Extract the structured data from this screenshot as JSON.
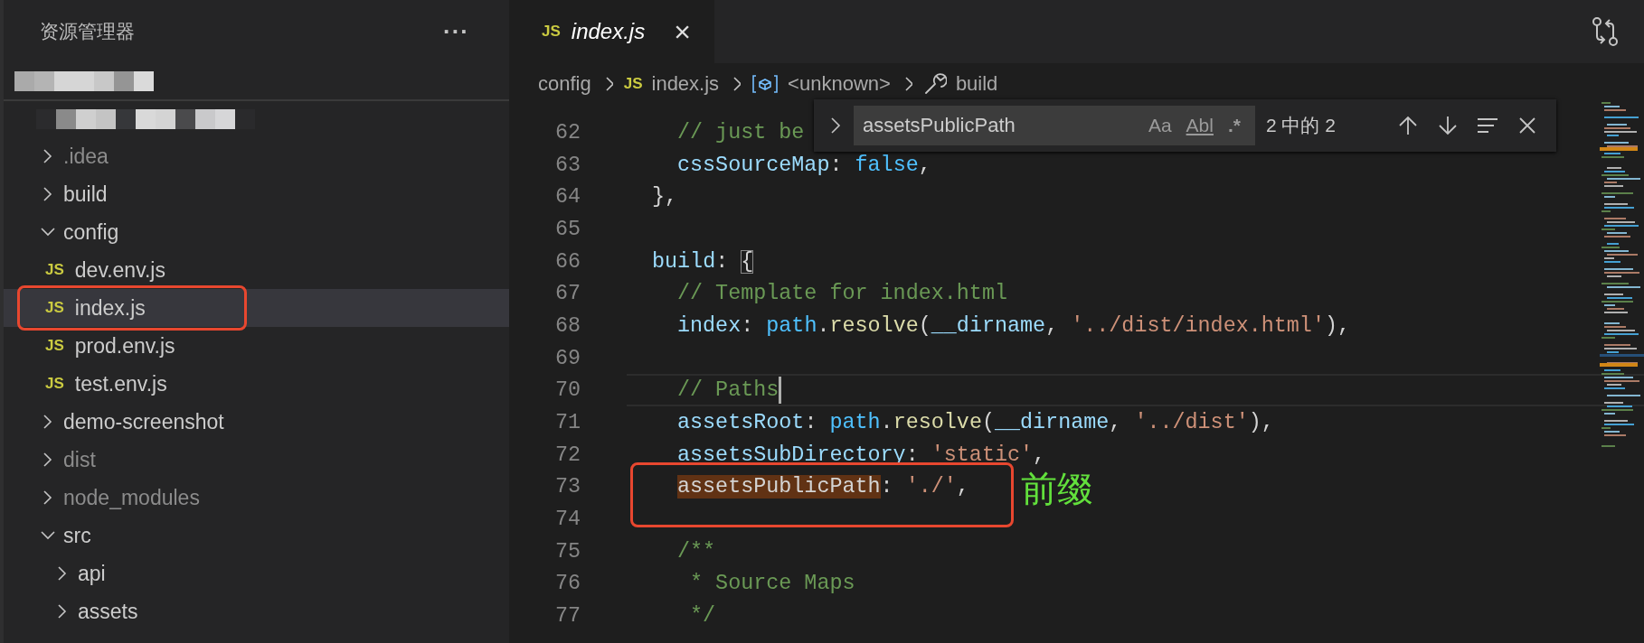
{
  "sidebar": {
    "title": "资源管理器",
    "more": "···",
    "redacted": [
      {
        "kind": "mosaic"
      },
      {
        "kind": "mosaic"
      }
    ],
    "tree": [
      {
        "label": ".idea",
        "kind": "folder",
        "expanded": false,
        "ignored": true,
        "selected": false
      },
      {
        "label": "build",
        "kind": "folder",
        "expanded": false,
        "ignored": false,
        "selected": false
      },
      {
        "label": "config",
        "kind": "folder",
        "expanded": true,
        "ignored": false,
        "selected": false,
        "children": [
          {
            "label": "dev.env.js",
            "kind": "file",
            "icon": "JS",
            "ignored": false,
            "selected": false
          },
          {
            "label": "index.js",
            "kind": "file",
            "icon": "JS",
            "ignored": false,
            "selected": true,
            "annotated": true
          },
          {
            "label": "prod.env.js",
            "kind": "file",
            "icon": "JS",
            "ignored": false,
            "selected": false
          },
          {
            "label": "test.env.js",
            "kind": "file",
            "icon": "JS",
            "ignored": false,
            "selected": false
          }
        ]
      },
      {
        "label": "demo-screenshot",
        "kind": "folder",
        "expanded": false,
        "ignored": false,
        "selected": false
      },
      {
        "label": "dist",
        "kind": "folder",
        "expanded": false,
        "ignored": true,
        "selected": false
      },
      {
        "label": "node_modules",
        "kind": "folder",
        "expanded": false,
        "ignored": true,
        "selected": false
      },
      {
        "label": "src",
        "kind": "folder",
        "expanded": true,
        "ignored": false,
        "selected": false,
        "children": [
          {
            "label": "api",
            "kind": "folder",
            "expanded": false,
            "ignored": false,
            "selected": false
          },
          {
            "label": "assets",
            "kind": "folder",
            "expanded": false,
            "ignored": false,
            "selected": false
          }
        ]
      }
    ]
  },
  "editor": {
    "tabs": [
      {
        "icon": "JS",
        "label": "index.js",
        "selected": true,
        "close": "×"
      }
    ],
    "actions": [
      {
        "kind": "compare"
      }
    ],
    "breadcrumbs": [
      {
        "kind": "folder",
        "label": "config"
      },
      {
        "kind": "file",
        "icon": "JS",
        "label": "index.js"
      },
      {
        "kind": "symbol",
        "label": "<unknown>"
      },
      {
        "kind": "property",
        "label": "build"
      }
    ],
    "lines": [
      {
        "number": "62",
        "kind": "indent2",
        "tokens": [
          {
            "kind": "comment",
            "text": "// just be"
          }
        ]
      },
      {
        "number": "63",
        "kind": "indent2",
        "tokens": [
          {
            "kind": "prop",
            "text": "cssSourceMap"
          },
          {
            "kind": "punct",
            "text": ": "
          },
          {
            "kind": "var",
            "text": "false"
          },
          {
            "kind": "punct",
            "text": ","
          }
        ]
      },
      {
        "number": "64",
        "kind": "indent1",
        "tokens": [
          {
            "kind": "punct",
            "text": "},"
          }
        ]
      },
      {
        "number": "65"
      },
      {
        "number": "66",
        "kind": "indent1",
        "tokens": [
          {
            "kind": "prop",
            "text": "build"
          },
          {
            "kind": "punct",
            "text": ": "
          },
          {
            "kind": "bracket",
            "text": "{"
          }
        ]
      },
      {
        "number": "67",
        "kind": "indent2",
        "tokens": [
          {
            "kind": "comment",
            "text": "// Template for index.html"
          }
        ]
      },
      {
        "number": "68",
        "kind": "indent2",
        "tokens": [
          {
            "kind": "prop",
            "text": "index"
          },
          {
            "kind": "punct",
            "text": ": "
          },
          {
            "kind": "var",
            "text": "path"
          },
          {
            "kind": "punct",
            "text": "."
          },
          {
            "kind": "fn",
            "text": "resolve"
          },
          {
            "kind": "punct",
            "text": "("
          },
          {
            "kind": "prop",
            "text": "__dirname"
          },
          {
            "kind": "punct",
            "text": ", "
          },
          {
            "kind": "str",
            "text": "'../dist/index.html'"
          },
          {
            "kind": "punct",
            "text": "),"
          }
        ]
      },
      {
        "number": "69"
      },
      {
        "number": "70",
        "kind": "indent2",
        "current": true,
        "tokens": [
          {
            "kind": "comment",
            "text": "// Paths"
          }
        ]
      },
      {
        "number": "71",
        "kind": "indent2",
        "tokens": [
          {
            "kind": "prop",
            "text": "assetsRoot"
          },
          {
            "kind": "punct",
            "text": ": "
          },
          {
            "kind": "var",
            "text": "path"
          },
          {
            "kind": "punct",
            "text": "."
          },
          {
            "kind": "fn",
            "text": "resolve"
          },
          {
            "kind": "punct",
            "text": "("
          },
          {
            "kind": "prop",
            "text": "__dirname"
          },
          {
            "kind": "punct",
            "text": ", "
          },
          {
            "kind": "str",
            "text": "'../dist'"
          },
          {
            "kind": "punct",
            "text": "),"
          }
        ]
      },
      {
        "number": "72",
        "kind": "indent2",
        "tokens": [
          {
            "kind": "prop",
            "text": "assetsSubDirectory"
          },
          {
            "kind": "punct",
            "text": ": "
          },
          {
            "kind": "str",
            "text": "'static'"
          },
          {
            "kind": "punct",
            "text": ","
          }
        ]
      },
      {
        "number": "73",
        "kind": "indent2",
        "annotated": true,
        "note": "前缀",
        "tokens": [
          {
            "kind": "match",
            "text": "assetsPublicPath"
          },
          {
            "kind": "punct",
            "text": ": "
          },
          {
            "kind": "str",
            "text": "'./'"
          },
          {
            "kind": "punct",
            "text": ","
          }
        ]
      },
      {
        "number": "74"
      },
      {
        "number": "75",
        "kind": "indent2",
        "tokens": [
          {
            "kind": "comment",
            "text": "/**"
          }
        ]
      },
      {
        "number": "76",
        "kind": "indent2",
        "tokens": [
          {
            "kind": "comment",
            "text": " * Source Maps"
          }
        ]
      },
      {
        "number": "77",
        "kind": "indent2",
        "tokens": [
          {
            "kind": "comment",
            "text": " */"
          }
        ]
      }
    ],
    "find": {
      "value": "assetsPublicPath",
      "replace_expanded": false,
      "options": [
        {
          "kind": "case",
          "label": "Aa",
          "on": false
        },
        {
          "kind": "word",
          "label": "Abl",
          "on": false
        },
        {
          "kind": "regex",
          "label": ".*",
          "on": false
        }
      ],
      "count": "2 中的 2",
      "buttons": [
        {
          "kind": "previous"
        },
        {
          "kind": "next"
        },
        {
          "kind": "selection"
        },
        {
          "kind": "close"
        }
      ]
    },
    "minimap": {
      "kind": "overview"
    }
  }
}
